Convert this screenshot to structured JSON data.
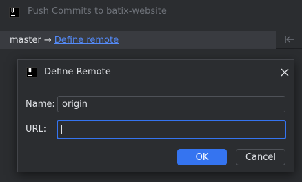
{
  "background_window": {
    "title": "Push Commits to batix-website",
    "branch": "master",
    "arrow": "→",
    "remote_link": "Define remote",
    "logo_text": "IJ"
  },
  "dialog": {
    "title": "Define Remote",
    "logo_text": "IJ",
    "close_glyph": "✕",
    "name_label": "Name:",
    "name_value": "origin",
    "url_label": "URL:",
    "url_value": "",
    "ok_label": "OK",
    "cancel_label": "Cancel"
  },
  "colors": {
    "accent": "#3574f0",
    "link": "#548af7",
    "background": "#2b2d30",
    "text": "#dfe1e5"
  }
}
